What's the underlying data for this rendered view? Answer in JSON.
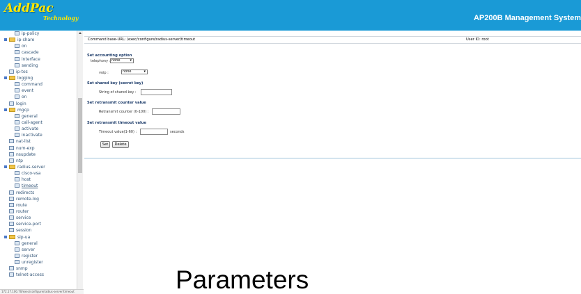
{
  "header": {
    "logo_main": "AddPac",
    "logo_sub": "Technology",
    "title": "AP200B Management System"
  },
  "sidebar": {
    "items": [
      {
        "label": "ip-policy",
        "level": 1,
        "type": "leaf"
      },
      {
        "label": "ip-share",
        "level": 0,
        "type": "folder"
      },
      {
        "label": "on",
        "level": 1,
        "type": "leaf"
      },
      {
        "label": "cascade",
        "level": 1,
        "type": "leaf"
      },
      {
        "label": "interface",
        "level": 1,
        "type": "leaf"
      },
      {
        "label": "sending",
        "level": 1,
        "type": "leaf"
      },
      {
        "label": "ip-tos",
        "level": 0,
        "type": "leaf"
      },
      {
        "label": "logging",
        "level": 0,
        "type": "folder"
      },
      {
        "label": "command",
        "level": 1,
        "type": "leaf"
      },
      {
        "label": "event",
        "level": 1,
        "type": "leaf"
      },
      {
        "label": "on",
        "level": 1,
        "type": "leaf"
      },
      {
        "label": "login",
        "level": 0,
        "type": "leaf"
      },
      {
        "label": "mgcp",
        "level": 0,
        "type": "folder"
      },
      {
        "label": "general",
        "level": 1,
        "type": "leaf"
      },
      {
        "label": "call-agent",
        "level": 1,
        "type": "leaf"
      },
      {
        "label": "activate",
        "level": 1,
        "type": "leaf"
      },
      {
        "label": "inactivate",
        "level": 1,
        "type": "leaf"
      },
      {
        "label": "nat-list",
        "level": 0,
        "type": "leaf"
      },
      {
        "label": "num-exp",
        "level": 0,
        "type": "leaf"
      },
      {
        "label": "nsupdate",
        "level": 0,
        "type": "leaf"
      },
      {
        "label": "ntp",
        "level": 0,
        "type": "leaf"
      },
      {
        "label": "radius-server",
        "level": 0,
        "type": "folder"
      },
      {
        "label": "cisco-vsa",
        "level": 1,
        "type": "leaf"
      },
      {
        "label": "host",
        "level": 1,
        "type": "leaf"
      },
      {
        "label": "timeout",
        "level": 1,
        "type": "leaf",
        "selected": true
      },
      {
        "label": "redirects",
        "level": 0,
        "type": "leaf"
      },
      {
        "label": "remote-log",
        "level": 0,
        "type": "leaf"
      },
      {
        "label": "route",
        "level": 0,
        "type": "leaf"
      },
      {
        "label": "router",
        "level": 0,
        "type": "leaf"
      },
      {
        "label": "service",
        "level": 0,
        "type": "leaf"
      },
      {
        "label": "service-port",
        "level": 0,
        "type": "leaf"
      },
      {
        "label": "session",
        "level": 0,
        "type": "leaf"
      },
      {
        "label": "sip-ua",
        "level": 0,
        "type": "folder"
      },
      {
        "label": "general",
        "level": 1,
        "type": "leaf"
      },
      {
        "label": "server",
        "level": 1,
        "type": "leaf"
      },
      {
        "label": "register",
        "level": 1,
        "type": "leaf"
      },
      {
        "label": "unregister",
        "level": 1,
        "type": "leaf"
      },
      {
        "label": "snmp",
        "level": 0,
        "type": "leaf"
      },
      {
        "label": "telnet-access",
        "level": 0,
        "type": "leaf"
      }
    ],
    "status_text": "172.17.100.70/exec/configure/radius-server/timeout"
  },
  "main": {
    "command_url": "Command base-URL: /exec/configure/radius-server/timeout",
    "user_id": "User ID: root",
    "accounting": {
      "title": "Set accounting option",
      "telephony_label": "telephony :",
      "telephony_value": "none",
      "voip_label": "voip :",
      "voip_value": "none"
    },
    "shared_key": {
      "title": "Set shared key (secret key)",
      "label": "String of shared key :",
      "value": ""
    },
    "retransmit": {
      "title": "Set retransmit counter value",
      "label": "Retransmit counter (0-100) :",
      "value": ""
    },
    "timeout": {
      "title": "Set retransmit timeout value",
      "label": "Timeout value(1-60) :",
      "value": "",
      "unit": "seconds"
    },
    "buttons": {
      "set": "Set",
      "delete": "Delete"
    }
  },
  "caption": "Parameters"
}
